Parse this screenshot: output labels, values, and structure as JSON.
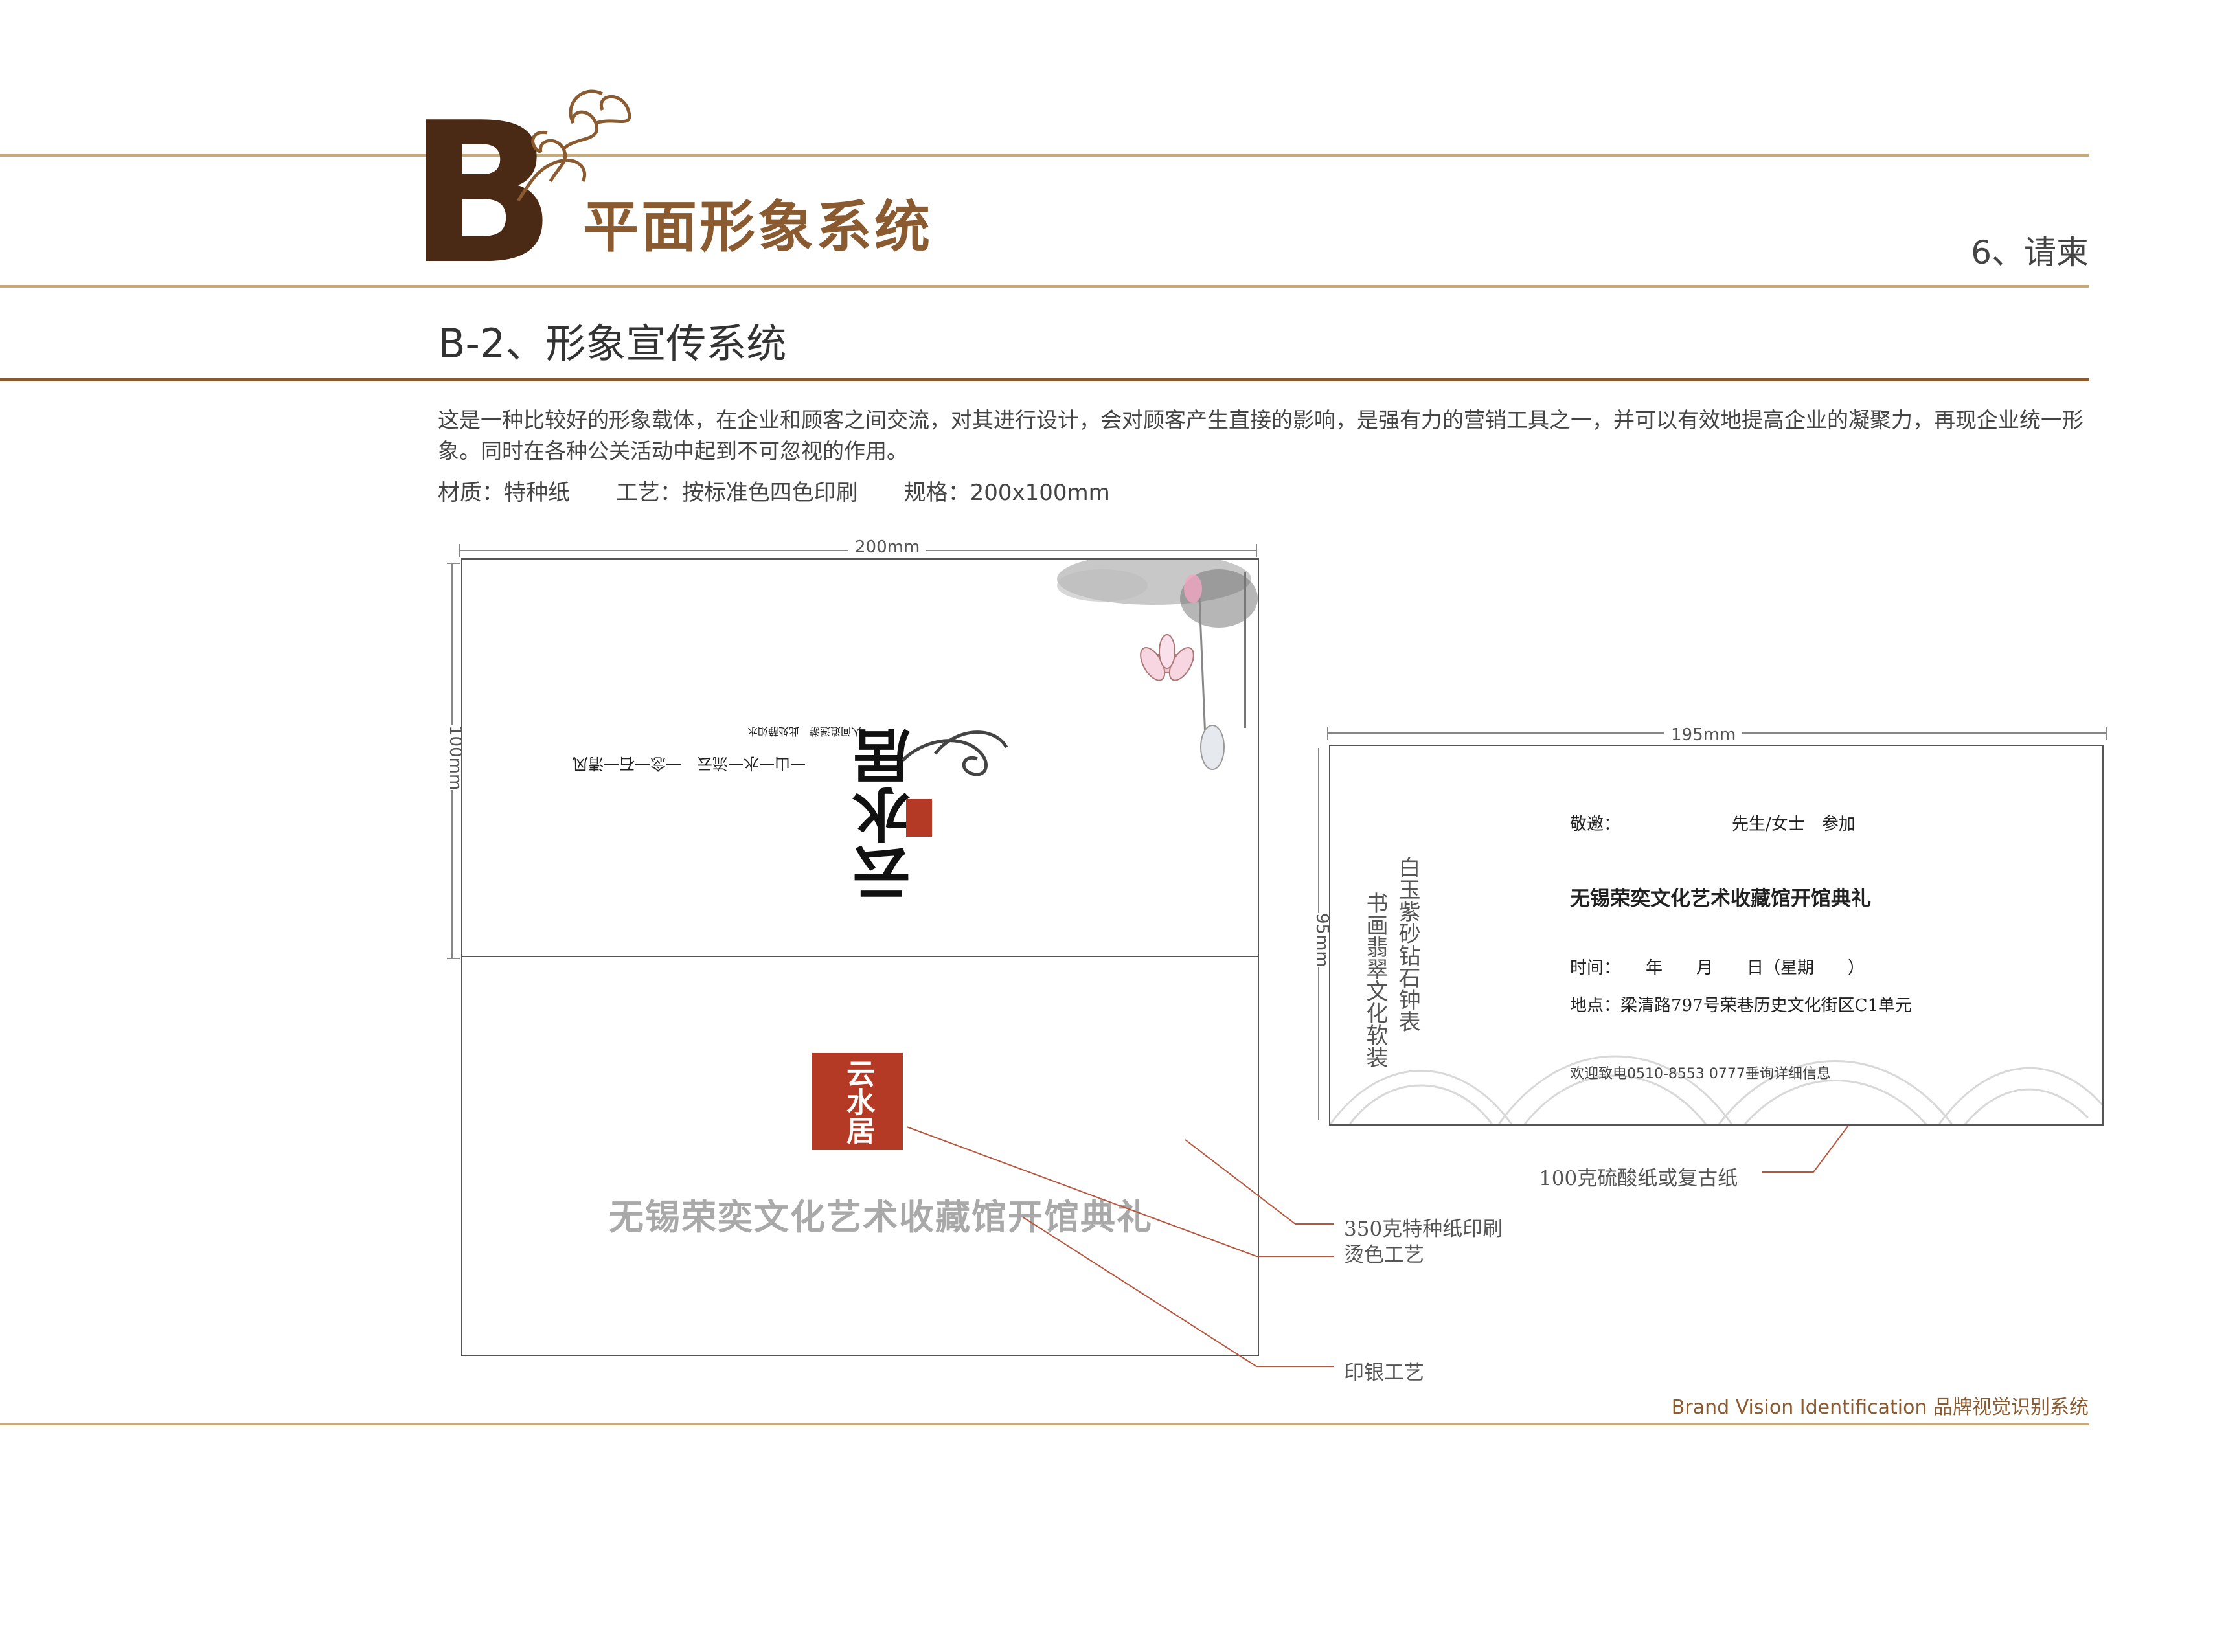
{
  "header": {
    "letter": "B",
    "title": "平面形象系统",
    "page_item": "6、请柬",
    "subtitle": "B-2、形象宣传系统"
  },
  "description": {
    "text": "这是一种比较好的形象载体，在企业和顾客之间交流，对其进行设计，会对顾客产生直接的影响，是强有力的营销工具之一，并可以有效地提高企业的凝聚力，再现企业统一形象。同时在各种公关活动中起到不可忽视的作用。",
    "material": "材质：特种纸",
    "process": "工艺：按标准色四色印刷",
    "size": "规格：200x100mm"
  },
  "envelope": {
    "width_label": "200mm",
    "height_label": "100mm",
    "brand_name": "云水居",
    "tagline_1": "一山一水一流云　一念一石一清风",
    "tagline_2": "人间逍遥游　此处静如水",
    "seal_text": "云水居",
    "event_title": "无锡荣奕文化艺术收藏馆开馆典礼"
  },
  "card": {
    "width_label": "195mm",
    "height_label": "95mm",
    "invite_line": "敬邀：",
    "guest_line": "先生/女士　参加",
    "event_title": "无锡荣奕文化艺术收藏馆开馆典礼",
    "time_line": "时间：　　年　　月　　日（星期　　）",
    "place_line": "地点：梁清路797号荣巷历史文化街区C1单元",
    "contact_line": "欢迎致电0510-8553 0777垂询详细信息",
    "side_col_1": "白玉紫砂钻石钟表",
    "side_col_2": "书画翡翠文化软装"
  },
  "callouts": {
    "paper_card": "100克硫酸纸或复古纸",
    "paper_envelope": "350克特种纸印刷",
    "foil": "烫色工艺",
    "silver": "印银工艺"
  },
  "footer": {
    "text": "Brand Vision Identification 品牌视觉识别系统"
  },
  "colors": {
    "brown_line": "#8a5a30",
    "gold_line": "#c7a97a",
    "seal_red": "#b53a26",
    "callout_line": "#b5573f"
  }
}
